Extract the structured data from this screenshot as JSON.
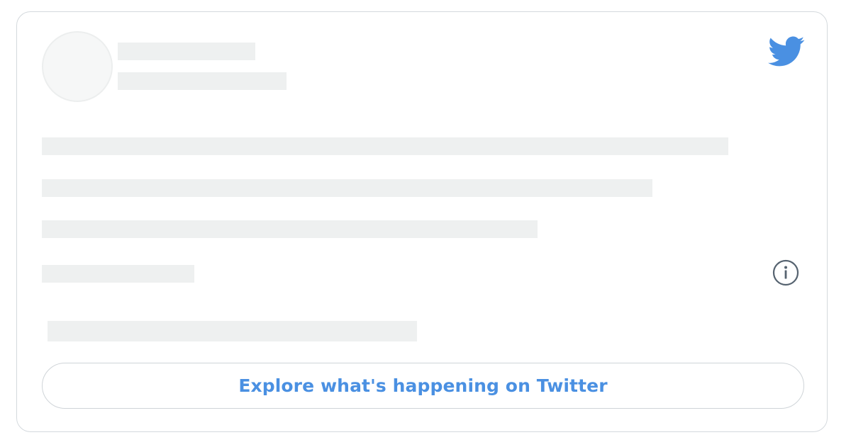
{
  "embed": {
    "brand": "twitter",
    "icons": {
      "logo": "twitter-bird-icon",
      "info": "info-icon"
    },
    "colors": {
      "accent": "#4a90e2",
      "skeleton": "#eef0f0",
      "border": "#d4d9dd"
    },
    "explore_button_label": "Explore what's happening on Twitter"
  }
}
